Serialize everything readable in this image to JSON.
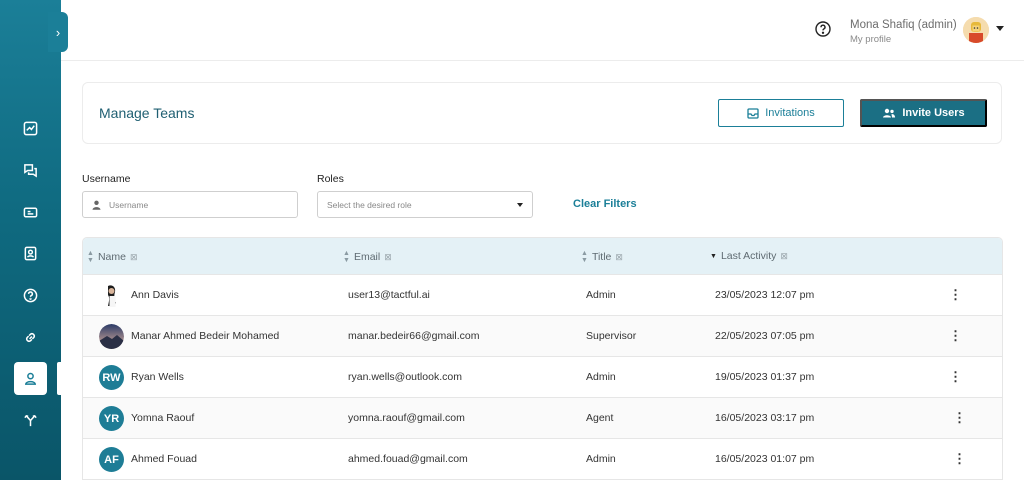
{
  "sidebar": {
    "items": [
      {
        "icon": "chart-icon"
      },
      {
        "icon": "chat-icon"
      },
      {
        "icon": "ticket-icon"
      },
      {
        "icon": "contact-icon"
      },
      {
        "icon": "help-icon"
      },
      {
        "icon": "link-icon"
      },
      {
        "icon": "user-icon",
        "active": true
      },
      {
        "icon": "branch-icon"
      }
    ]
  },
  "topbar": {
    "user_name": "Mona Shafiq (admin)",
    "user_sub": "My profile"
  },
  "header": {
    "title": "Manage Teams",
    "invitations_label": "Invitations",
    "invite_label": "Invite Users"
  },
  "filters": {
    "username_label": "Username",
    "username_placeholder": "Username",
    "roles_label": "Roles",
    "roles_placeholder": "Select the desired role",
    "clear_label": "Clear Filters"
  },
  "table": {
    "columns": [
      "Name",
      "Email",
      "Title",
      "Last Activity"
    ],
    "rows": [
      {
        "name": "Ann Davis",
        "email": "user13@tactful.ai",
        "title": "Admin",
        "last_activity": "23/05/2023 12:07 pm",
        "avatar": "photo"
      },
      {
        "name": "Manar Ahmed Bedeir Mohamed",
        "email": "manar.bedeir66@gmail.com",
        "title": "Supervisor",
        "last_activity": "22/05/2023 07:05 pm",
        "avatar": "photo"
      },
      {
        "name": "Ryan Wells",
        "email": "ryan.wells@outlook.com",
        "title": "Admin",
        "last_activity": "19/05/2023 01:37 pm",
        "initials": "RW"
      },
      {
        "name": "Yomna Raouf",
        "email": "yomna.raouf@gmail.com",
        "title": "Agent",
        "last_activity": "16/05/2023 03:17 pm",
        "initials": "YR"
      },
      {
        "name": "Ahmed Fouad",
        "email": "ahmed.fouad@gmail.com",
        "title": "Admin",
        "last_activity": "16/05/2023 01:07 pm",
        "initials": "AF"
      }
    ]
  },
  "colors": {
    "brand": "#1b7f98",
    "button_dark": "#1b6f84",
    "header_row": "#e4f1f6",
    "initials_avatar": "#1e7d96"
  }
}
